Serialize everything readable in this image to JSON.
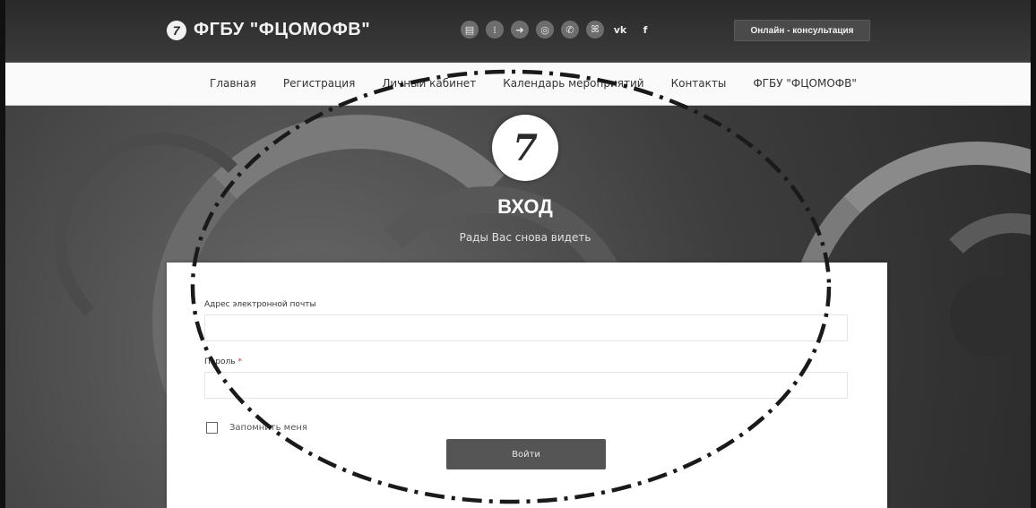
{
  "header": {
    "brand": "ФГБУ \"ФЦОМОФВ\"",
    "brand_logo_glyph": "7",
    "social_icons": [
      {
        "name": "id-card-icon",
        "glyph": "▤"
      },
      {
        "name": "person-icon",
        "glyph": "⁞"
      },
      {
        "name": "login-arrow-icon",
        "glyph": "➜"
      },
      {
        "name": "instagram-icon",
        "glyph": "◎"
      },
      {
        "name": "whatsapp-icon",
        "glyph": "✆"
      },
      {
        "name": "odnoklassniki-icon",
        "glyph": "ꕤ"
      },
      {
        "name": "vk-icon",
        "glyph": "vk"
      },
      {
        "name": "facebook-icon",
        "glyph": "f"
      }
    ],
    "consult_button": "Онлайн - консультация"
  },
  "nav": {
    "items": [
      "Главная",
      "Регистрация",
      "Личный кабинет",
      "Календарь мероприятий",
      "Контакты",
      "ФГБУ \"ФЦОМОФВ\""
    ]
  },
  "hero": {
    "logo_glyph": "7",
    "title": "ВХОД",
    "subtitle": "Рады Вас снова видеть"
  },
  "form": {
    "email_label": "Адрес электронной почты",
    "email_value": "",
    "password_label": "Пароль",
    "password_required_mark": "*",
    "password_value": "",
    "remember_label": "Запомнить меня",
    "remember_checked": false,
    "submit_label": "Войти"
  },
  "colors": {
    "topbar": "#2a2a2a",
    "nav_bg": "#fafafa",
    "button": "#555555",
    "annotation": "#1a1a1a"
  }
}
